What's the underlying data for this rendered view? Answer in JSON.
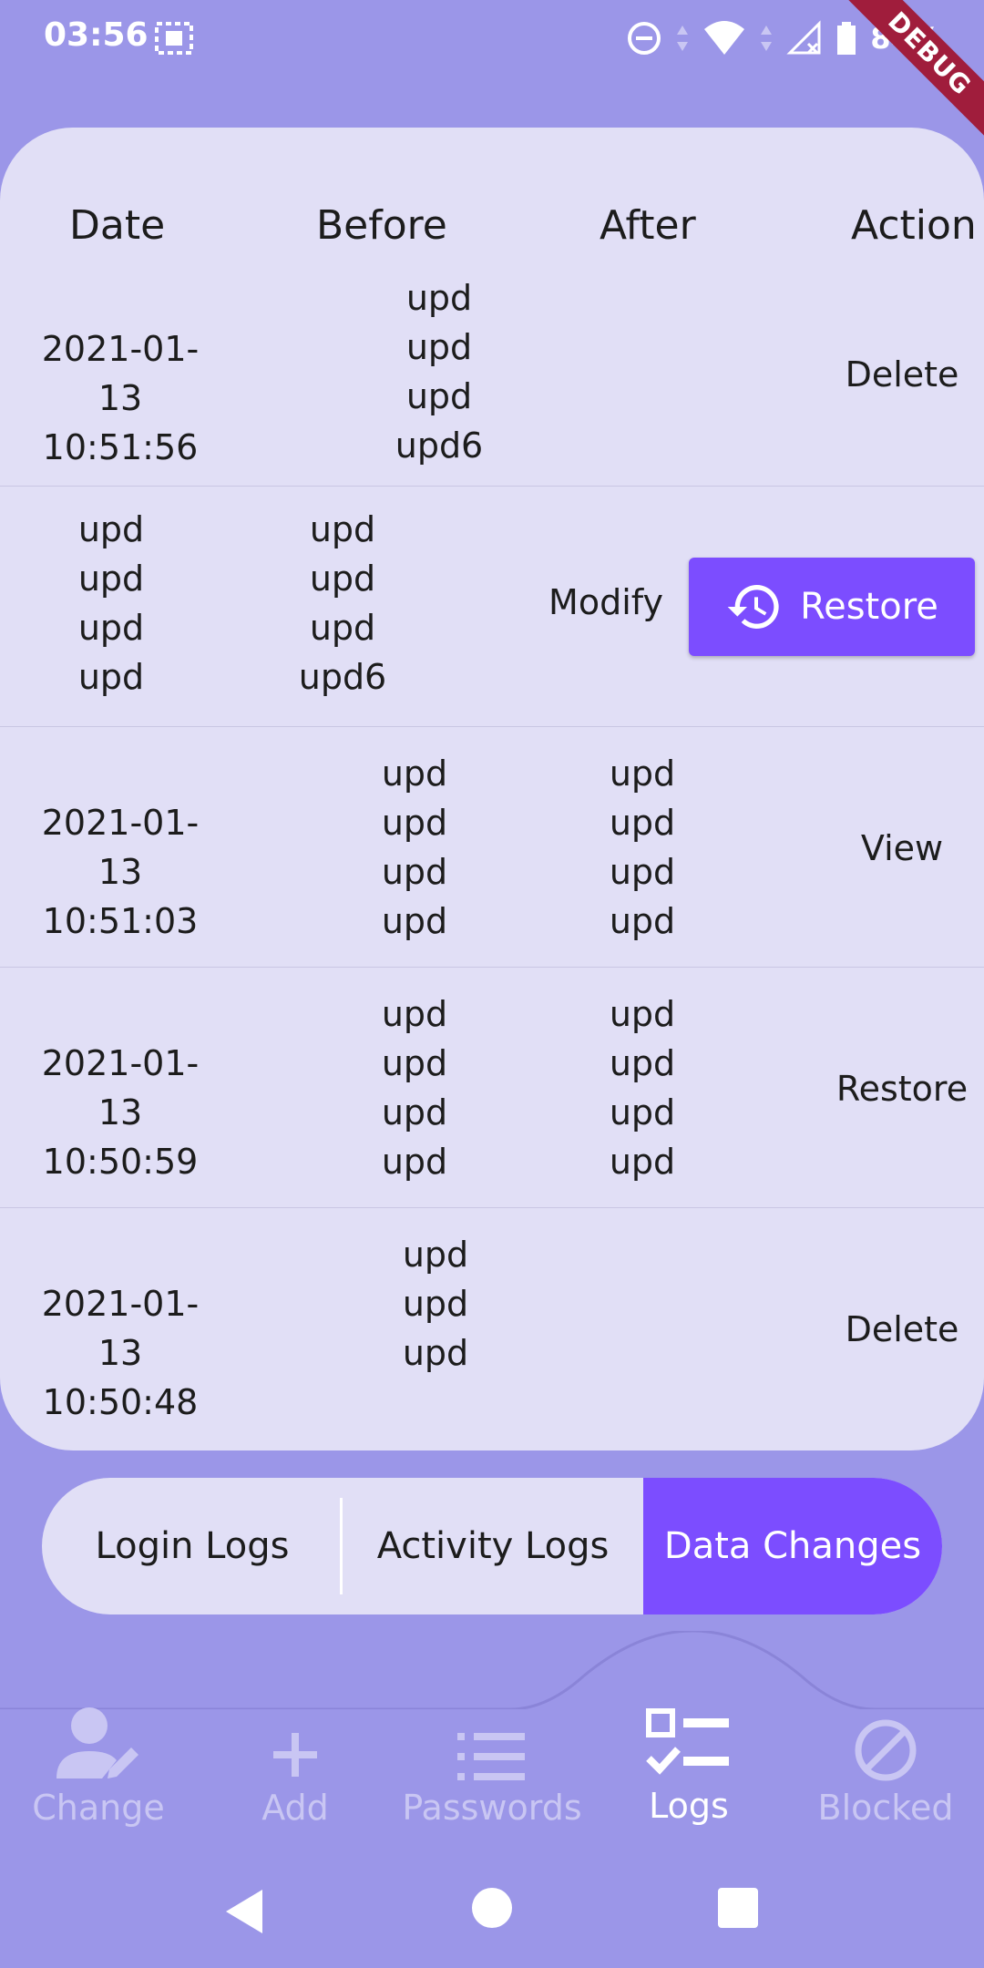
{
  "status_bar": {
    "time": "03:56",
    "battery": "84%"
  },
  "debug_label": "DEBUG",
  "table": {
    "headers": {
      "date": "Date",
      "before": "Before",
      "after": "After",
      "action": "Action"
    },
    "rows": [
      {
        "date_line1": "2021-01-13",
        "date_line2": "10:51:56",
        "before": [
          "upd",
          "upd",
          "upd",
          "upd6"
        ],
        "after": [],
        "action": "Delete"
      },
      {
        "date_line1": "",
        "date_line2": "",
        "col_a": [
          "upd",
          "upd",
          "upd",
          "upd"
        ],
        "col_b": [
          "upd",
          "upd",
          "upd",
          "upd6"
        ],
        "action": "Modify",
        "restore_button": "Restore"
      },
      {
        "date_line1": "2021-01-13",
        "date_line2": "10:51:03",
        "before": [
          "upd",
          "upd",
          "upd",
          "upd"
        ],
        "after": [
          "upd",
          "upd",
          "upd",
          "upd"
        ],
        "action": "View"
      },
      {
        "date_line1": "2021-01-13",
        "date_line2": "10:50:59",
        "before": [
          "upd",
          "upd",
          "upd",
          "upd"
        ],
        "after": [
          "upd",
          "upd",
          "upd",
          "upd"
        ],
        "action": "Restore"
      },
      {
        "date_line1": "2021-01-13",
        "date_line2": "10:50:48",
        "before": [
          "upd",
          "upd",
          "upd"
        ],
        "after": [],
        "action": "Delete"
      }
    ]
  },
  "segments": [
    "Login Logs",
    "Activity Logs",
    "Data Changes"
  ],
  "selected_segment": "Data Changes",
  "bottom_nav": [
    {
      "label": "Change",
      "icon": "user-edit-icon"
    },
    {
      "label": "Add",
      "icon": "plus-icon"
    },
    {
      "label": "Passwords",
      "icon": "list-icon"
    },
    {
      "label": "Logs",
      "icon": "checklist-icon"
    },
    {
      "label": "Blocked",
      "icon": "block-icon"
    }
  ],
  "active_nav": "Logs",
  "colors": {
    "background": "#9b96e8",
    "card": "#e1dff6",
    "accent": "#7c4dff",
    "debug": "#a01d3c"
  }
}
